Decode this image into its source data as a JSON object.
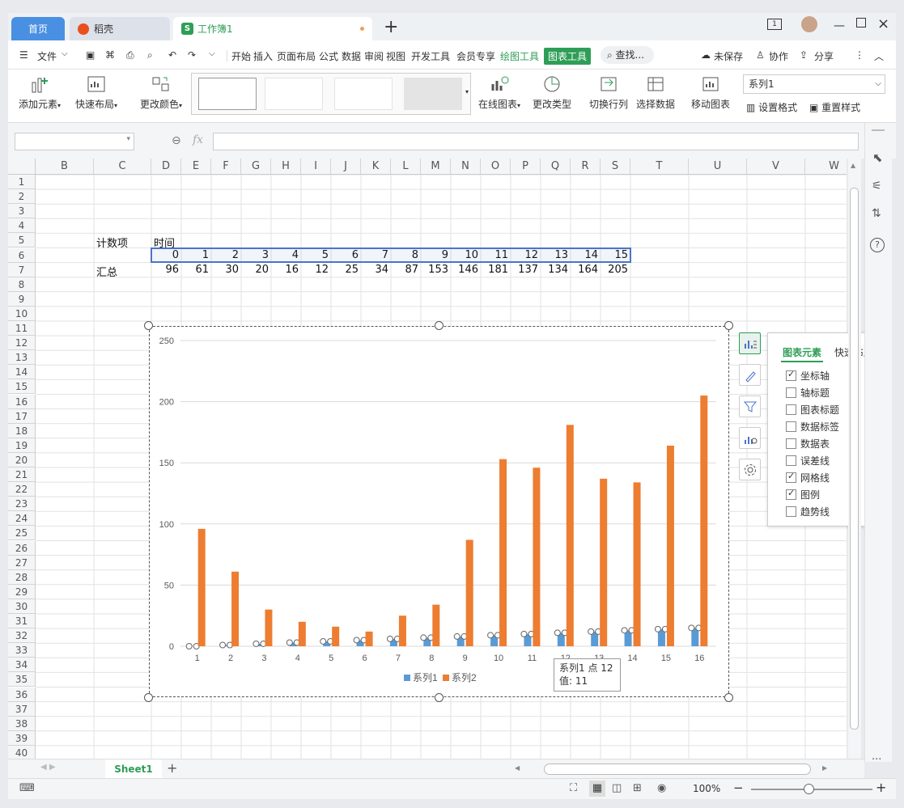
{
  "tabs": {
    "home": "首页",
    "daoke": "稻壳",
    "workbook": "工作簿1"
  },
  "menu": {
    "file": "文件",
    "items": [
      "开始",
      "插入",
      "页面布局",
      "公式",
      "数据",
      "审阅",
      "视图",
      "开发工具",
      "会员专享"
    ],
    "draw_tools": "绘图工具",
    "chart_tools": "图表工具",
    "search": "查找...",
    "unsaved": "未保存",
    "collab": "协作",
    "share": "分享"
  },
  "ribbon": {
    "add_element": "添加元素",
    "quick_layout": "快速布局",
    "change_color": "更改颜色",
    "online_chart": "在线图表",
    "change_type": "更改类型",
    "switch_rowcol": "切换行列",
    "select_data": "选择数据",
    "move_chart": "移动图表",
    "series_select": "系列1",
    "set_format": "设置格式",
    "reset_style": "重置样式"
  },
  "grid": {
    "columns": [
      "B",
      "C",
      "D",
      "E",
      "F",
      "G",
      "H",
      "I",
      "J",
      "K",
      "L",
      "M",
      "N",
      "O",
      "P",
      "Q",
      "R",
      "S",
      "T",
      "U",
      "V",
      "W"
    ],
    "rows": [
      "1",
      "2",
      "3",
      "4",
      "5",
      "6",
      "7",
      "8",
      "9",
      "10",
      "11",
      "12",
      "13",
      "14",
      "15",
      "16",
      "17",
      "18",
      "19",
      "20",
      "21",
      "22",
      "23",
      "24",
      "25",
      "26",
      "27",
      "28",
      "29",
      "30",
      "31",
      "32",
      "33",
      "34",
      "35",
      "36",
      "37",
      "38",
      "39",
      "40"
    ],
    "label_count": "计数项",
    "label_time": "时间",
    "label_total": "汇总",
    "time_values": [
      "0",
      "1",
      "2",
      "3",
      "4",
      "5",
      "6",
      "7",
      "8",
      "9",
      "10",
      "11",
      "12",
      "13",
      "14",
      "15"
    ],
    "total_values": [
      "96",
      "61",
      "30",
      "20",
      "16",
      "12",
      "25",
      "34",
      "87",
      "153",
      "146",
      "181",
      "137",
      "134",
      "164",
      "205"
    ]
  },
  "chart_data": {
    "type": "bar",
    "categories": [
      "1",
      "2",
      "3",
      "4",
      "5",
      "6",
      "7",
      "8",
      "9",
      "10",
      "11",
      "12",
      "13",
      "14",
      "15",
      "16"
    ],
    "series": [
      {
        "name": "系列1",
        "color": "#5b9bd5",
        "values": [
          0,
          1,
          2,
          3,
          4,
          5,
          6,
          7,
          8,
          9,
          10,
          11,
          12,
          13,
          14,
          15
        ]
      },
      {
        "name": "系列2",
        "color": "#ed7d31",
        "values": [
          96,
          61,
          30,
          20,
          16,
          12,
          25,
          34,
          87,
          153,
          146,
          181,
          137,
          134,
          164,
          205
        ]
      }
    ],
    "ylim": [
      0,
      250
    ],
    "yticks": [
      "0",
      "50",
      "100",
      "150",
      "200",
      "250"
    ],
    "grid": true,
    "legend": "bottom"
  },
  "tooltip": {
    "line1": "系列1 点 12",
    "line2": "值: 11"
  },
  "panel": {
    "tab_elements": "图表元素",
    "tab_layout": "快速布局",
    "items": [
      {
        "label": "坐标轴",
        "checked": true
      },
      {
        "label": "轴标题",
        "checked": false
      },
      {
        "label": "图表标题",
        "checked": false
      },
      {
        "label": "数据标签",
        "checked": false
      },
      {
        "label": "数据表",
        "checked": false
      },
      {
        "label": "误差线",
        "checked": false
      },
      {
        "label": "网格线",
        "checked": true
      },
      {
        "label": "图例",
        "checked": true
      },
      {
        "label": "趋势线",
        "checked": false
      }
    ]
  },
  "sheet": {
    "tab": "Sheet1"
  },
  "status": {
    "zoom": "100%"
  },
  "colors": {
    "accent_green": "#2e9e57",
    "tab_blue": "#4a90e2",
    "series1": "#5b9bd5",
    "series2": "#ed7d31"
  }
}
